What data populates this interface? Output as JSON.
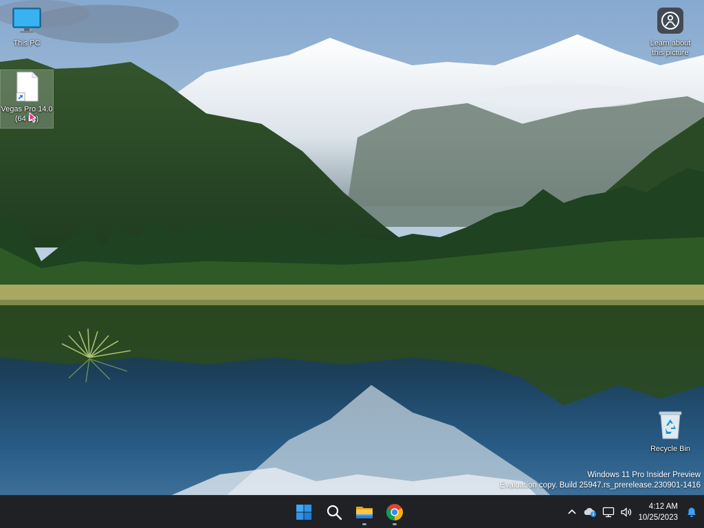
{
  "desktop": {
    "icons": [
      {
        "label": "This PC",
        "icon": "monitor-icon"
      },
      {
        "label": "Vegas Pro 14.0 (64 bit)",
        "icon": "blank-file-shortcut-icon"
      },
      {
        "label": "Learn about this picture",
        "icon": "camera-info-icon"
      },
      {
        "label": "Recycle Bin",
        "icon": "recycle-bin-icon"
      }
    ]
  },
  "watermark": {
    "line1": "Windows 11 Pro Insider Preview",
    "line2": "Evaluation copy. Build 25947.rs_prerelease.230901-1416"
  },
  "taskbar": {
    "pinned": [
      {
        "name": "Start",
        "icon": "windows-start-icon"
      },
      {
        "name": "Search",
        "icon": "search-icon"
      },
      {
        "name": "File Explorer",
        "icon": "folder-icon",
        "running": true
      },
      {
        "name": "Google Chrome",
        "icon": "chrome-icon",
        "running": true
      }
    ],
    "tray": {
      "icons": [
        "chevron-up-icon",
        "weather-info-icon",
        "network-icon",
        "volume-icon"
      ],
      "time": "4:12 AM",
      "date": "10/25/2023",
      "notification_icon": "bell-icon"
    },
    "colors": {
      "background": "#1f2125",
      "accent": "#0a84ff"
    }
  }
}
